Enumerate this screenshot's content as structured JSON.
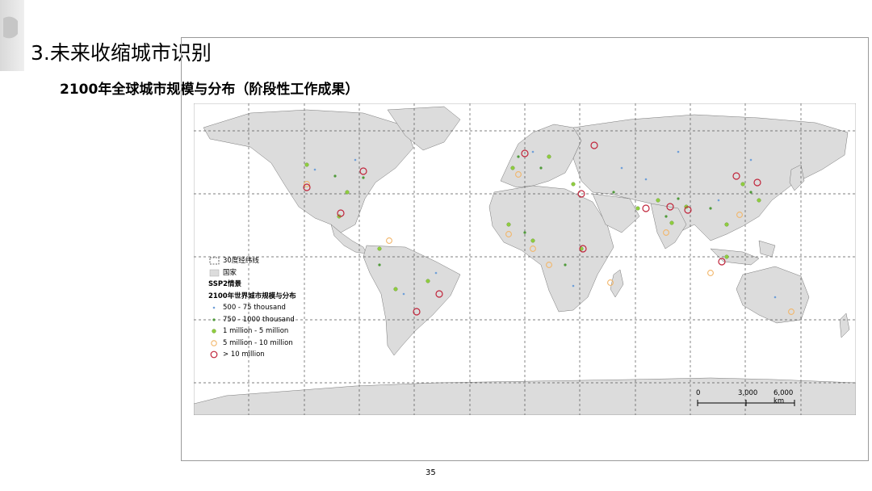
{
  "header": {
    "title": "3.未来收缩城市识别",
    "subtitle": "2100年全球城市规模与分布（阶段性工作成果）"
  },
  "legend": {
    "graticule_label": "30度经纬线",
    "country_label": "国家",
    "scenario_label": "SSP2情景",
    "title": "2100年世界城市规模与分布",
    "classes": [
      {
        "label": "500 - 75 thousand",
        "color": "#6f9fd8",
        "symbol": "small-dot"
      },
      {
        "label": "750 - 1000 thousand",
        "color": "#4f9a3a",
        "symbol": "small-dot"
      },
      {
        "label": "1 million - 5 million",
        "color": "#8fcd3f",
        "symbol": "dot"
      },
      {
        "label": "5 million - 10 million",
        "color": "#f2b66a",
        "symbol": "ring"
      },
      {
        "label": "> 10 million",
        "color": "#c0243a",
        "symbol": "ring"
      }
    ]
  },
  "scale_bar": {
    "labels": [
      "0",
      "3,000",
      "6,000 km"
    ]
  },
  "page_number": "35"
}
